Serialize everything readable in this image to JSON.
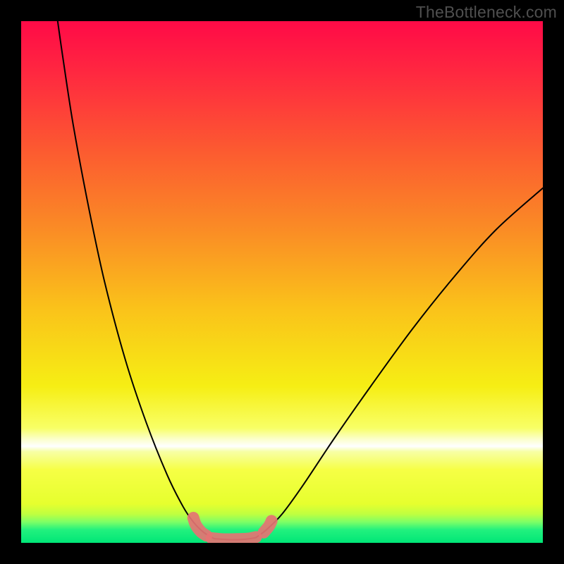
{
  "watermark": "TheBottleneck.com",
  "chart_data": {
    "type": "line",
    "title": "",
    "xlabel": "",
    "ylabel": "",
    "xlim": [
      0,
      100
    ],
    "ylim": [
      0,
      100
    ],
    "background_gradient": [
      {
        "stop": 0.0,
        "color": "#ff0a47"
      },
      {
        "stop": 0.1,
        "color": "#ff2840"
      },
      {
        "stop": 0.25,
        "color": "#fc5b30"
      },
      {
        "stop": 0.4,
        "color": "#fa8c25"
      },
      {
        "stop": 0.55,
        "color": "#fac21a"
      },
      {
        "stop": 0.7,
        "color": "#f6ee14"
      },
      {
        "stop": 0.78,
        "color": "#f8ff66"
      },
      {
        "stop": 0.8,
        "color": "#fbffc6"
      },
      {
        "stop": 0.815,
        "color": "#ffffff"
      },
      {
        "stop": 0.825,
        "color": "#f7ffa6"
      },
      {
        "stop": 0.86,
        "color": "#f6ff45"
      },
      {
        "stop": 0.925,
        "color": "#e6ff2e"
      },
      {
        "stop": 0.945,
        "color": "#bfff40"
      },
      {
        "stop": 0.96,
        "color": "#7dff66"
      },
      {
        "stop": 0.975,
        "color": "#22f17e"
      },
      {
        "stop": 1.0,
        "color": "#00e677"
      }
    ],
    "series": [
      {
        "name": "left-curve",
        "color": "#000000",
        "points": [
          {
            "x": 7.0,
            "y": 100.0
          },
          {
            "x": 8.0,
            "y": 93.0
          },
          {
            "x": 10.0,
            "y": 80.0
          },
          {
            "x": 13.0,
            "y": 64.0
          },
          {
            "x": 16.0,
            "y": 50.0
          },
          {
            "x": 20.0,
            "y": 35.0
          },
          {
            "x": 24.0,
            "y": 23.0
          },
          {
            "x": 28.0,
            "y": 13.0
          },
          {
            "x": 31.0,
            "y": 7.0
          },
          {
            "x": 33.0,
            "y": 4.0
          },
          {
            "x": 35.0,
            "y": 2.0
          },
          {
            "x": 37.0,
            "y": 0.8
          }
        ]
      },
      {
        "name": "flat-bottom",
        "color": "#000000",
        "points": [
          {
            "x": 37.0,
            "y": 0.8
          },
          {
            "x": 40.0,
            "y": 0.6
          },
          {
            "x": 43.0,
            "y": 0.7
          },
          {
            "x": 45.0,
            "y": 1.0
          }
        ]
      },
      {
        "name": "right-curve",
        "color": "#000000",
        "points": [
          {
            "x": 45.0,
            "y": 1.0
          },
          {
            "x": 47.0,
            "y": 2.5
          },
          {
            "x": 50.0,
            "y": 5.5
          },
          {
            "x": 54.0,
            "y": 11.0
          },
          {
            "x": 60.0,
            "y": 20.0
          },
          {
            "x": 67.0,
            "y": 30.0
          },
          {
            "x": 75.0,
            "y": 41.0
          },
          {
            "x": 83.0,
            "y": 51.0
          },
          {
            "x": 91.0,
            "y": 60.0
          },
          {
            "x": 100.0,
            "y": 68.0
          }
        ]
      }
    ],
    "markers": [
      {
        "name": "valley-left",
        "color": "#e57373",
        "points": [
          {
            "x": 33.0,
            "y": 4.8
          },
          {
            "x": 33.5,
            "y": 3.4
          },
          {
            "x": 34.5,
            "y": 2.1
          },
          {
            "x": 35.5,
            "y": 1.4
          }
        ]
      },
      {
        "name": "valley-bottom",
        "color": "#e57373",
        "points": [
          {
            "x": 36.5,
            "y": 0.9
          },
          {
            "x": 38.5,
            "y": 0.7
          },
          {
            "x": 41.0,
            "y": 0.7
          },
          {
            "x": 43.5,
            "y": 0.8
          },
          {
            "x": 45.0,
            "y": 1.1
          }
        ]
      },
      {
        "name": "valley-right",
        "color": "#e57373",
        "points": [
          {
            "x": 46.5,
            "y": 2.0
          },
          {
            "x": 47.5,
            "y": 3.2
          },
          {
            "x": 48.0,
            "y": 4.2
          }
        ]
      }
    ]
  }
}
